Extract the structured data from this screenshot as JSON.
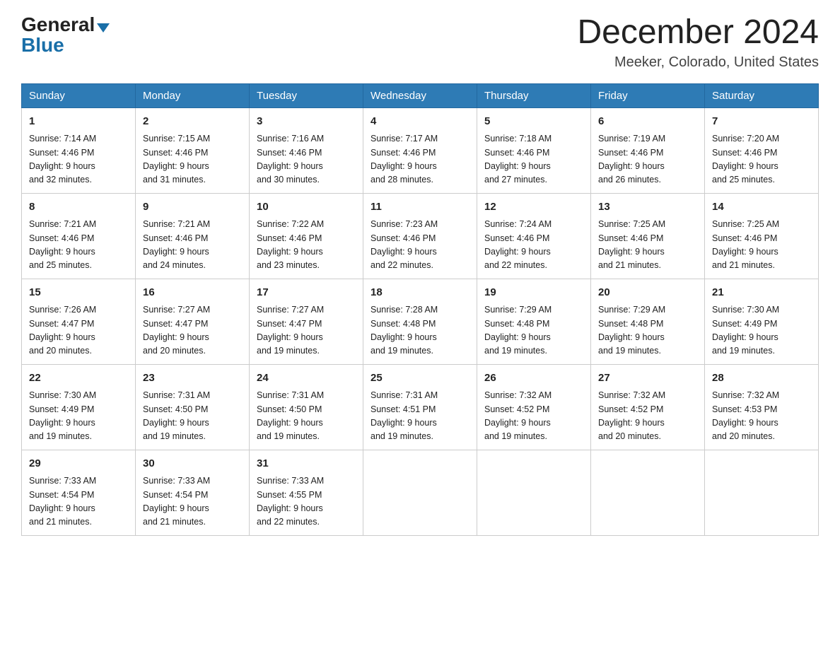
{
  "header": {
    "logo_text_general": "General",
    "logo_text_blue": "Blue",
    "month_title": "December 2024",
    "location": "Meeker, Colorado, United States"
  },
  "weekdays": [
    "Sunday",
    "Monday",
    "Tuesday",
    "Wednesday",
    "Thursday",
    "Friday",
    "Saturday"
  ],
  "weeks": [
    [
      {
        "day": "1",
        "sunrise": "7:14 AM",
        "sunset": "4:46 PM",
        "daylight": "9 hours and 32 minutes."
      },
      {
        "day": "2",
        "sunrise": "7:15 AM",
        "sunset": "4:46 PM",
        "daylight": "9 hours and 31 minutes."
      },
      {
        "day": "3",
        "sunrise": "7:16 AM",
        "sunset": "4:46 PM",
        "daylight": "9 hours and 30 minutes."
      },
      {
        "day": "4",
        "sunrise": "7:17 AM",
        "sunset": "4:46 PM",
        "daylight": "9 hours and 28 minutes."
      },
      {
        "day": "5",
        "sunrise": "7:18 AM",
        "sunset": "4:46 PM",
        "daylight": "9 hours and 27 minutes."
      },
      {
        "day": "6",
        "sunrise": "7:19 AM",
        "sunset": "4:46 PM",
        "daylight": "9 hours and 26 minutes."
      },
      {
        "day": "7",
        "sunrise": "7:20 AM",
        "sunset": "4:46 PM",
        "daylight": "9 hours and 25 minutes."
      }
    ],
    [
      {
        "day": "8",
        "sunrise": "7:21 AM",
        "sunset": "4:46 PM",
        "daylight": "9 hours and 25 minutes."
      },
      {
        "day": "9",
        "sunrise": "7:21 AM",
        "sunset": "4:46 PM",
        "daylight": "9 hours and 24 minutes."
      },
      {
        "day": "10",
        "sunrise": "7:22 AM",
        "sunset": "4:46 PM",
        "daylight": "9 hours and 23 minutes."
      },
      {
        "day": "11",
        "sunrise": "7:23 AM",
        "sunset": "4:46 PM",
        "daylight": "9 hours and 22 minutes."
      },
      {
        "day": "12",
        "sunrise": "7:24 AM",
        "sunset": "4:46 PM",
        "daylight": "9 hours and 22 minutes."
      },
      {
        "day": "13",
        "sunrise": "7:25 AM",
        "sunset": "4:46 PM",
        "daylight": "9 hours and 21 minutes."
      },
      {
        "day": "14",
        "sunrise": "7:25 AM",
        "sunset": "4:46 PM",
        "daylight": "9 hours and 21 minutes."
      }
    ],
    [
      {
        "day": "15",
        "sunrise": "7:26 AM",
        "sunset": "4:47 PM",
        "daylight": "9 hours and 20 minutes."
      },
      {
        "day": "16",
        "sunrise": "7:27 AM",
        "sunset": "4:47 PM",
        "daylight": "9 hours and 20 minutes."
      },
      {
        "day": "17",
        "sunrise": "7:27 AM",
        "sunset": "4:47 PM",
        "daylight": "9 hours and 19 minutes."
      },
      {
        "day": "18",
        "sunrise": "7:28 AM",
        "sunset": "4:48 PM",
        "daylight": "9 hours and 19 minutes."
      },
      {
        "day": "19",
        "sunrise": "7:29 AM",
        "sunset": "4:48 PM",
        "daylight": "9 hours and 19 minutes."
      },
      {
        "day": "20",
        "sunrise": "7:29 AM",
        "sunset": "4:48 PM",
        "daylight": "9 hours and 19 minutes."
      },
      {
        "day": "21",
        "sunrise": "7:30 AM",
        "sunset": "4:49 PM",
        "daylight": "9 hours and 19 minutes."
      }
    ],
    [
      {
        "day": "22",
        "sunrise": "7:30 AM",
        "sunset": "4:49 PM",
        "daylight": "9 hours and 19 minutes."
      },
      {
        "day": "23",
        "sunrise": "7:31 AM",
        "sunset": "4:50 PM",
        "daylight": "9 hours and 19 minutes."
      },
      {
        "day": "24",
        "sunrise": "7:31 AM",
        "sunset": "4:50 PM",
        "daylight": "9 hours and 19 minutes."
      },
      {
        "day": "25",
        "sunrise": "7:31 AM",
        "sunset": "4:51 PM",
        "daylight": "9 hours and 19 minutes."
      },
      {
        "day": "26",
        "sunrise": "7:32 AM",
        "sunset": "4:52 PM",
        "daylight": "9 hours and 19 minutes."
      },
      {
        "day": "27",
        "sunrise": "7:32 AM",
        "sunset": "4:52 PM",
        "daylight": "9 hours and 20 minutes."
      },
      {
        "day": "28",
        "sunrise": "7:32 AM",
        "sunset": "4:53 PM",
        "daylight": "9 hours and 20 minutes."
      }
    ],
    [
      {
        "day": "29",
        "sunrise": "7:33 AM",
        "sunset": "4:54 PM",
        "daylight": "9 hours and 21 minutes."
      },
      {
        "day": "30",
        "sunrise": "7:33 AM",
        "sunset": "4:54 PM",
        "daylight": "9 hours and 21 minutes."
      },
      {
        "day": "31",
        "sunrise": "7:33 AM",
        "sunset": "4:55 PM",
        "daylight": "9 hours and 22 minutes."
      },
      null,
      null,
      null,
      null
    ]
  ],
  "labels": {
    "sunrise": "Sunrise:",
    "sunset": "Sunset:",
    "daylight": "Daylight:"
  }
}
